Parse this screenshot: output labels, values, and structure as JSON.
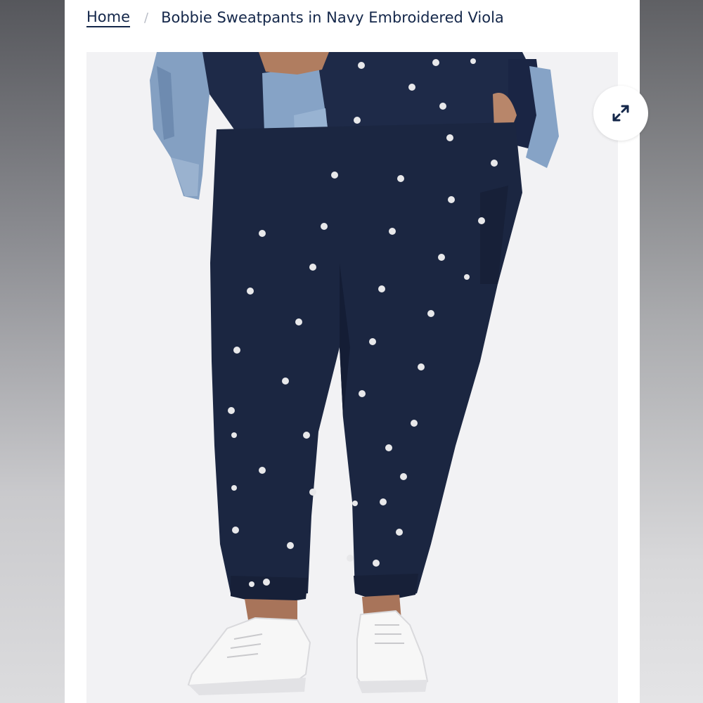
{
  "breadcrumb": {
    "home_label": "Home",
    "separator": "/",
    "current_label": "Bobbie Sweatpants in Navy Embroidered Viola"
  },
  "product_image": {
    "expand_icon": "expand-arrows-icon"
  },
  "colors": {
    "brand_navy": "#14274a",
    "pants_navy": "#1b2641",
    "denim": "#7f9cbd"
  }
}
